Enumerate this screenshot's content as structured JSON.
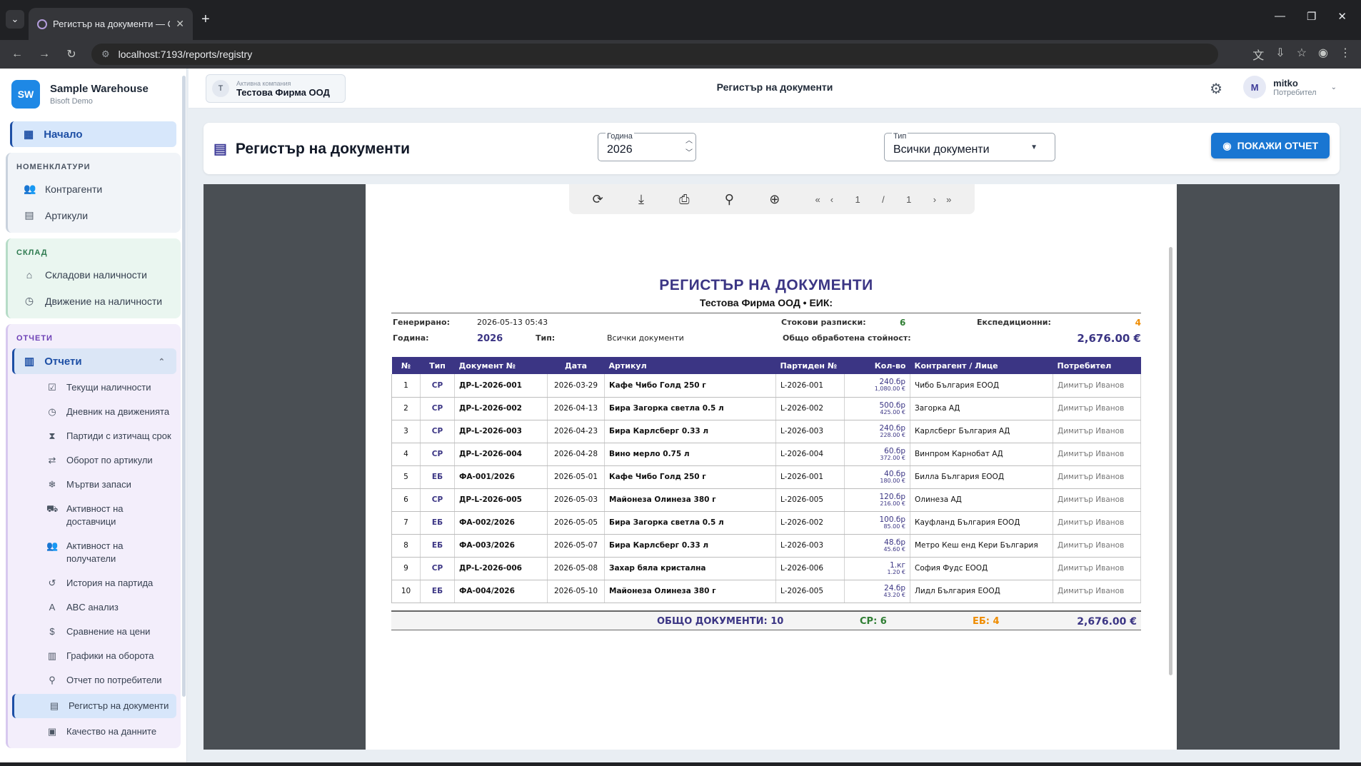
{
  "browser": {
    "tab_title": "Регистър на документи — Отч",
    "url": "localhost:7193/reports/registry"
  },
  "brand": {
    "name": "Sample Warehouse",
    "sub": "Bisoft Demo",
    "logo": "SW"
  },
  "nav": {
    "home": "Начало",
    "sections": {
      "nomenclature": {
        "title": "НОМЕНКЛАТУРИ",
        "items": [
          "Контрагенти",
          "Артикули"
        ]
      },
      "warehouse": {
        "title": "СКЛАД",
        "items": [
          "Складови наличности",
          "Движение на наличности"
        ]
      },
      "reports": {
        "title": "ОТЧЕТИ",
        "group": "Отчети",
        "items": [
          "Текущи наличности",
          "Дневник на движенията",
          "Партиди с изтичащ срок",
          "Оборот по артикули",
          "Мъртви запаси",
          "Активност на доставчици",
          "Активност на получатели",
          "История на партида",
          "ABC анализ",
          "Сравнение на цени",
          "Графики на оборота",
          "Отчет по потребители",
          "Регистър на документи",
          "Качество на данните"
        ]
      }
    }
  },
  "header": {
    "company_label": "Активна компания",
    "company_name": "Тестова Фирма ООД",
    "company_initial": "T",
    "title": "Регистър на документи",
    "user_name": "mitko",
    "user_role": "Потребител",
    "user_initial": "M"
  },
  "filters": {
    "title": "Регистър на документи",
    "year_label": "Година",
    "year_value": "2026",
    "type_label": "Тип",
    "type_value": "Всички документи",
    "show_button": "ПОКАЖИ ОТЧЕТ"
  },
  "viewer": {
    "page_current": "1",
    "page_sep": "/",
    "page_total": "1"
  },
  "report": {
    "title": "РЕГИСТЪР НА ДОКУМЕНТИ",
    "company_line": "Тестова Фирма ООД • ЕИК:",
    "generated_label": "Генерирано:",
    "generated_value": "2026-05-13 05:43",
    "year_label": "Година:",
    "year_value": "2026",
    "type_label": "Тип:",
    "type_value": "Всички документи",
    "receipts_label": "Стокови разписки:",
    "receipts_value": "6",
    "dispatch_label": "Експедиционни:",
    "dispatch_value": "4",
    "total_value_label": "Общо обработена стойност:",
    "total_value": "2,676.00 €",
    "columns": [
      "№",
      "Тип",
      "Документ №",
      "Дата",
      "Артикул",
      "Партиден №",
      "Кол-во",
      "Контрагент / Лице",
      "Потребител"
    ],
    "rows": [
      {
        "n": "1",
        "type": "СР",
        "doc": "ДР-L-2026-001",
        "date": "2026-03-29",
        "article": "Кафе Чибо Голд 250 г",
        "batch": "L-2026-001",
        "qty": "240.бр",
        "price": "1,080.00 €",
        "party": "Чибо България ЕООД",
        "user": "Димитър Иванов"
      },
      {
        "n": "2",
        "type": "СР",
        "doc": "ДР-L-2026-002",
        "date": "2026-04-13",
        "article": "Бира Загорка светла 0.5 л",
        "batch": "L-2026-002",
        "qty": "500.бр",
        "price": "425.00 €",
        "party": "Загорка АД",
        "user": "Димитър Иванов"
      },
      {
        "n": "3",
        "type": "СР",
        "doc": "ДР-L-2026-003",
        "date": "2026-04-23",
        "article": "Бира Карлсберг 0.33 л",
        "batch": "L-2026-003",
        "qty": "240.бр",
        "price": "228.00 €",
        "party": "Карлсберг България АД",
        "user": "Димитър Иванов"
      },
      {
        "n": "4",
        "type": "СР",
        "doc": "ДР-L-2026-004",
        "date": "2026-04-28",
        "article": "Вино мерло 0.75 л",
        "batch": "L-2026-004",
        "qty": "60.бр",
        "price": "372.00 €",
        "party": "Винпром Карнобат АД",
        "user": "Димитър Иванов"
      },
      {
        "n": "5",
        "type": "ЕБ",
        "doc": "ФА-001/2026",
        "date": "2026-05-01",
        "article": "Кафе Чибо Голд 250 г",
        "batch": "L-2026-001",
        "qty": "40.бр",
        "price": "180.00 €",
        "party": "Билла България ЕООД",
        "user": "Димитър Иванов"
      },
      {
        "n": "6",
        "type": "СР",
        "doc": "ДР-L-2026-005",
        "date": "2026-05-03",
        "article": "Майонеза Олинеза 380 г",
        "batch": "L-2026-005",
        "qty": "120.бр",
        "price": "216.00 €",
        "party": "Олинеза АД",
        "user": "Димитър Иванов"
      },
      {
        "n": "7",
        "type": "ЕБ",
        "doc": "ФА-002/2026",
        "date": "2026-05-05",
        "article": "Бира Загорка светла 0.5 л",
        "batch": "L-2026-002",
        "qty": "100.бр",
        "price": "85.00 €",
        "party": "Кауфланд България ЕООД",
        "user": "Димитър Иванов"
      },
      {
        "n": "8",
        "type": "ЕБ",
        "doc": "ФА-003/2026",
        "date": "2026-05-07",
        "article": "Бира Карлсберг 0.33 л",
        "batch": "L-2026-003",
        "qty": "48.бр",
        "price": "45.60 €",
        "party": "Метро Кеш енд Кери България",
        "user": "Димитър Иванов"
      },
      {
        "n": "9",
        "type": "СР",
        "doc": "ДР-L-2026-006",
        "date": "2026-05-08",
        "article": "Захар бяла кристална",
        "batch": "L-2026-006",
        "qty": "1.кг",
        "price": "1.20 €",
        "party": "София Фудс ЕООД",
        "user": "Димитър Иванов"
      },
      {
        "n": "10",
        "type": "ЕБ",
        "doc": "ФА-004/2026",
        "date": "2026-05-10",
        "article": "Майонеза Олинеза 380 г",
        "batch": "L-2026-005",
        "qty": "24.бр",
        "price": "43.20 €",
        "party": "Лидл България ЕООД",
        "user": "Димитър Иванов"
      }
    ],
    "total_docs": "ОБЩО ДОКУМЕНТИ: 10",
    "total_sr": "СР: 6",
    "total_eb": "ЕБ: 4",
    "total_amount": "2,676.00 €"
  },
  "colors": {
    "primary": "#3b3584",
    "accent": "#1976d2",
    "green": "#2e7d32",
    "orange": "#ef8c00"
  }
}
